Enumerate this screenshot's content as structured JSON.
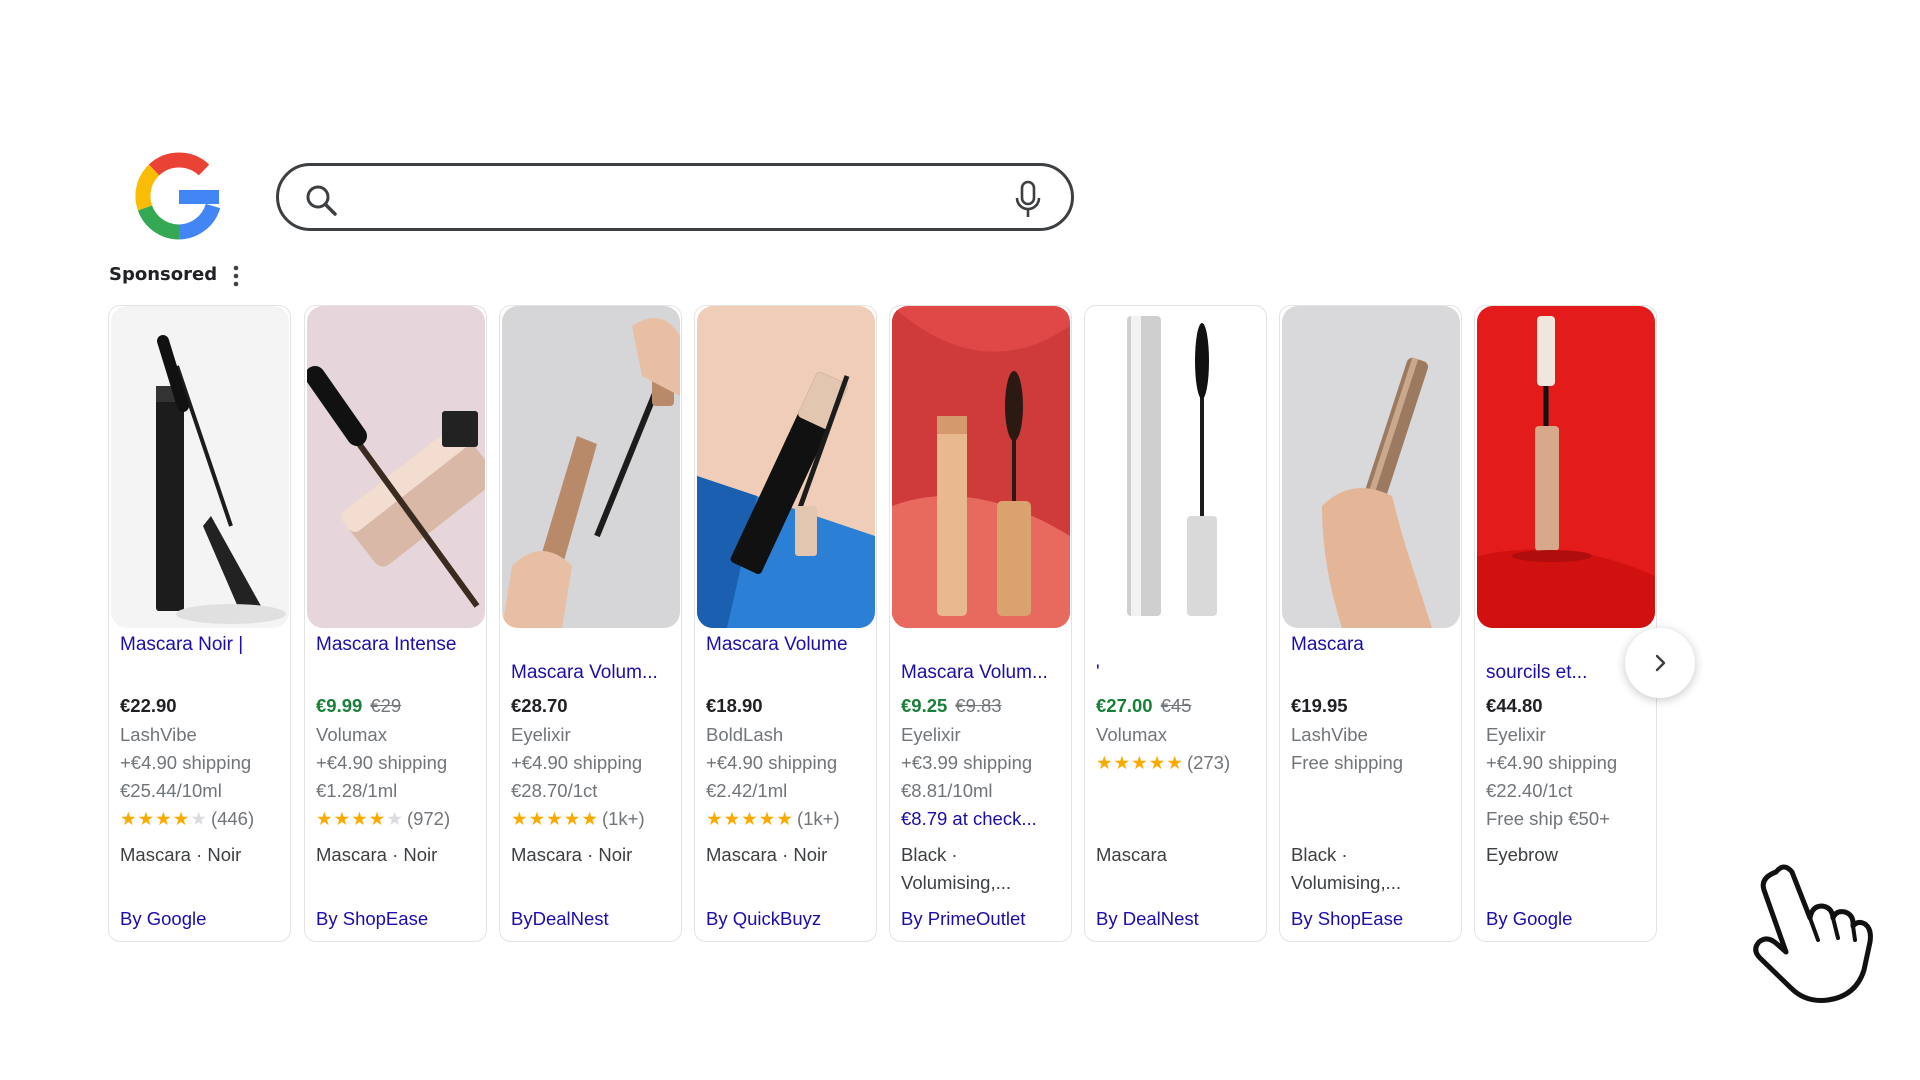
{
  "search": {
    "value": "",
    "placeholder": ""
  },
  "ads": {
    "label": "Sponsored"
  },
  "icons": {
    "logo": "google-g-logo",
    "search": "magnifier-icon",
    "voice": "microphone-icon",
    "menu": "three-dot-menu-icon",
    "next": "chevron-right-icon",
    "cursor": "hand-pointer-icon"
  },
  "colors": {
    "link": "#1a0dab",
    "sale": "#188038",
    "star": "#f9ab00"
  },
  "products": [
    {
      "title": "Mascara Noir |",
      "price": "€22.90",
      "was": "",
      "store": "LashVibe",
      "shipping": "+€4.90 shipping",
      "unit": "€25.44/10ml",
      "promo": "",
      "rating": 3.5,
      "stars": "★★★★",
      "stars_off": "★",
      "reviews": "(446)",
      "attr1": "Mascara · Noir",
      "attr2": "",
      "by": "By Google"
    },
    {
      "title": "Mascara Intense",
      "price": "€9.99",
      "was": "€29",
      "store": "Volumax",
      "shipping": "+€4.90 shipping",
      "unit": "€1.28/1ml",
      "promo": "",
      "rating": 4,
      "stars": "★★★★",
      "stars_off": "★",
      "reviews": "(972)",
      "attr1": "Mascara · Noir",
      "attr2": "",
      "by": "By ShopEase"
    },
    {
      "title": "Mascara Volum...",
      "price": "€28.70",
      "was": "",
      "store": "Eyelixir",
      "shipping": "+€4.90 shipping",
      "unit": "€28.70/1ct",
      "promo": "",
      "rating": 4.5,
      "stars": "★★★★★",
      "stars_off": "",
      "reviews": "(1k+)",
      "attr1": "Mascara · Noir",
      "attr2": "",
      "by": "ByDealNest"
    },
    {
      "title": "Mascara Volume",
      "price": "€18.90",
      "was": "",
      "store": "BoldLash",
      "shipping": "+€4.90 shipping",
      "unit": "€2.42/1ml",
      "promo": "",
      "rating": 4.5,
      "stars": "★★★★★",
      "stars_off": "",
      "reviews": "(1k+)",
      "attr1": "Mascara · Noir",
      "attr2": "",
      "by": "By QuickBuyz"
    },
    {
      "title": "Mascara Volum...",
      "price": "€9.25",
      "was": "€9.83",
      "store": "Eyelixir",
      "shipping": "+€3.99 shipping",
      "unit": "€8.81/10ml",
      "promo": "€8.79 at check...",
      "rating": 0,
      "stars": "",
      "stars_off": "",
      "reviews": "",
      "attr1": "Black ·",
      "attr2": "Volumising,...",
      "by": "By PrimeOutlet"
    },
    {
      "title": "'",
      "price": "€27.00",
      "was": "€45",
      "store": "Volumax",
      "shipping": "",
      "unit": "",
      "promo": "",
      "rating": 4.5,
      "stars": "★★★★★",
      "stars_off": "",
      "reviews": "(273)",
      "attr1": "Mascara",
      "attr2": "",
      "by": "By DealNest"
    },
    {
      "title": "Mascara",
      "price": "€19.95",
      "was": "",
      "store": "LashVibe",
      "shipping": "Free shipping",
      "unit": "",
      "promo": "",
      "rating": 0,
      "stars": "",
      "stars_off": "",
      "reviews": "",
      "attr1": "Black ·",
      "attr2": "Volumising,...",
      "by": "By ShopEase"
    },
    {
      "title": "sourcils et...",
      "price": "€44.80",
      "was": "",
      "store": "Eyelixir",
      "shipping": "+€4.90 shipping",
      "unit": "€22.40/1ct",
      "promo": "Free ship €50+",
      "rating": 0,
      "stars": "",
      "stars_off": "",
      "reviews": "",
      "attr1": "Eyebrow",
      "attr2": "",
      "by": "By Google"
    }
  ]
}
